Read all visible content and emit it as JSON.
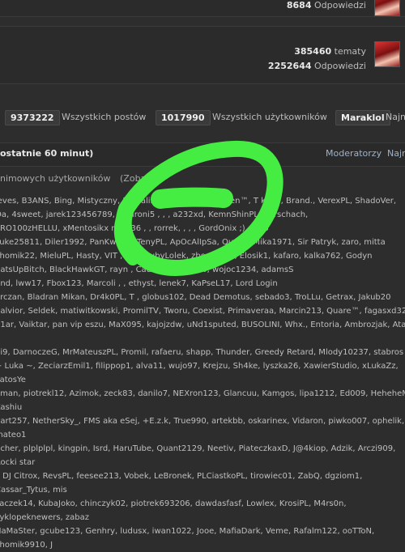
{
  "top": {
    "replies_count": "8684",
    "replies_label": "Odpowiedzi",
    "topics_count": "385460",
    "topics_label": "tematy",
    "replies2_count": "2252644",
    "replies2_label": "Odpowiedzi"
  },
  "stats": {
    "posts_value": "9373222",
    "posts_label": "Wszystkich postów",
    "users_value": "1017990",
    "users_label": "Wszystkich użytkowników",
    "newest_user": "Maraklol",
    "newest_label": "Najn"
  },
  "online": {
    "title": "ostatnie 60 minut)",
    "tab_moderators": "Moderatorzy",
    "tab_more": "Najn",
    "anonymous_text": "nimowych użytkowników",
    "show_link": "(Zoba"
  },
  "users_lines": [
    "leves, B3ANS, Bing, Mistyczny, Brusalin, Lord Asasin, Raiden™, T  ka12, Brand., VerexPL, ShadoVer,",
    "Oa, 4sweet, jarek123456789, Lin  ironi5  ,  ,  ,   a232xd, KemnShinPL, Rorschach,",
    "PRO100zHELLU, xMentosikx  mius36  ,  ,   rorrek,  ,  ,   , GordOnix ;), Xero",
    "suke25811, Diler1992, PanKwiat, , TenyPL, ApOcAlIpSa, Quake, Mika1971, Sir Patryk, zaro, mitta",
    "chomik22, MieluPL, Hasty, VIT  , TheGrubyLolek, zborek, ra  , Elosik1, kafaro, kalka762, Godyn",
    "hatsUpBitch, BlackHawkGT, rayn  , Cadar, SuHYmTW, wojoc1234, adamsS",
    "und, lww17, Fbox123, Marcoli  ,  , ethyst, lenek7, KaPseL17, Lord Login",
    "orczan, Bladran Mikan, Dr4k0PL, T  , globus102, Dead Demotus, sebado3, TroLLu, Getrax, Jakub20",
    "Salvior, Seldek, matiwitkowski, PromilTV, Tworu, Coexist, Primaveraa, Marcin213, Quare™, fagasxd32",
    "21ar, Vaiktar, pan vip eszu, MaX095, kajojzdw, uNd1sputed, BUSOLINI, Whx., Entoria, Ambrozjak, Atari, F",
    "bi9, DarnoczeG, MrMateuszPL, Promil, rafaeru, shapp, Thunder, Greedy Retard, Mlody10237, stabros",
    "~ Luka ~, ZeciarzEmil1, filippop1, alva11, wujo97, Krejzu, Sh4ke, lyszka26, XawierStudio, xLukaZz, PatosYe",
    "aman, piotrekl12, Azimok, zeck83, danilo7, NEXron123, Glancuu, Kamgos, lipa1212, Ed009, HeheheM, Kashiu",
    "part257, NetherSky_, FMS aka eSej, +E.z.k, True990, artekbb, oskarinex, Vidaron, piwko007, ophelik, mateo1",
    "ucher, plplplpl, kingpin, Isrd, HaruTube, Quant2129, Neetiv, PiateczkaxD, J@4kiop, Adzik, Arczi909, Rocki star",
    "i, DJ Citrox, RevsPL, feesee213, Vobek, LeBronek, PLCiastkoPL, tirowiec01, ZabQ, dgziom1, Cassar_Tytus, mis",
    "zaczek14, KubaJoko, chinczyk02, piotrek693206, dawdasfasf, Lowlex, KrosiPL, M4rs0n, cyklopeknewers, zabaz",
    "HaMaSter, gcube123, Genhry, ludusx, iwan1022, Jooe, MafiaDark, Veme, Rafalm122, ooTToN, chomik9910, J"
  ],
  "colors": {
    "background": "#2d2d2d",
    "marker_green": "#45ec42",
    "username_red": "#ff4c4c",
    "username_green": "#39d35a",
    "username_orange": "#ff8a3d",
    "username_yellow": "#ffd34d",
    "username_purple": "#b06cff"
  }
}
